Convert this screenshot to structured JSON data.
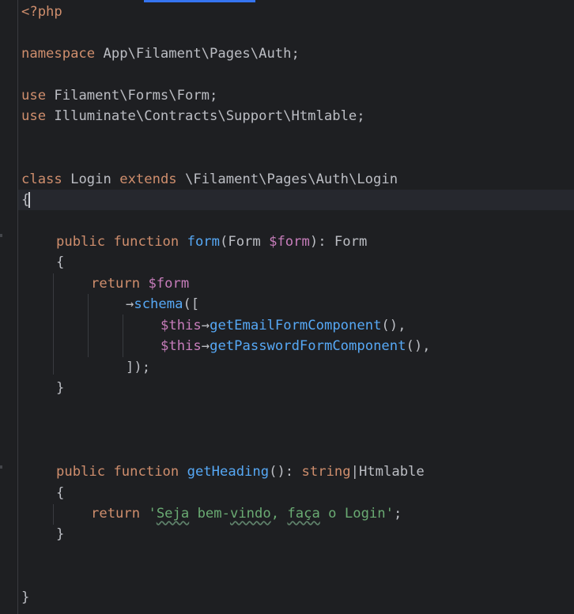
{
  "code": {
    "open_tag": "<?php",
    "kw_namespace": "namespace",
    "namespace_name": "App\\Filament\\Pages\\Auth;",
    "kw_use_1": "use",
    "use_1": "Filament\\Forms\\Form;",
    "kw_use_2": "use",
    "use_2": "Illuminate\\Contracts\\Support\\Htmlable;",
    "kw_class": "class",
    "class_name": "Login",
    "kw_extends": "extends",
    "parent_class": "\\Filament\\Pages\\Auth\\Login",
    "class_open_brace": "{",
    "kw_public_1": "public",
    "kw_function_1": "function",
    "fn_form": "form",
    "form_params_open": "(Form ",
    "var_form_param": "$form",
    "form_params_close": "): Form",
    "form_open_brace": "{",
    "kw_return_1": "return",
    "var_form_return": "$form",
    "arrow_schema": "→",
    "fn_schema": "schema",
    "schema_open": "([",
    "var_this_1": "$this",
    "arrow_1": "→",
    "fn_get_email": "getEmailFormComponent",
    "call_suffix_1": "(),",
    "var_this_2": "$this",
    "arrow_2": "→",
    "fn_get_password": "getPasswordFormComponent",
    "call_suffix_2": "(),",
    "schema_close": "]);",
    "form_close_brace": "}",
    "kw_public_2": "public",
    "kw_function_2": "function",
    "fn_get_heading": "getHeading",
    "heading_params": "(): ",
    "kw_string_type": "string",
    "union_pipe": "|",
    "type_htmlable": "Htmlable",
    "heading_open_brace": "{",
    "kw_return_2": "return",
    "str_quote_open": "'",
    "str_word_seja": "Seja",
    "str_mid_1": " bem-",
    "str_word_vindo": "vindo",
    "str_mid_2": ", ",
    "str_word_faca": "faça",
    "str_tail": " o Login'",
    "heading_semicolon": ";",
    "heading_close_brace": "}",
    "class_close_brace": "}"
  }
}
